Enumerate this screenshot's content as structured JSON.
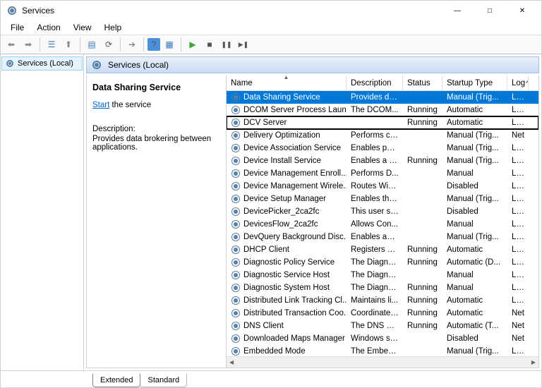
{
  "window": {
    "title": "Services"
  },
  "menu": {
    "file": "File",
    "action": "Action",
    "view": "View",
    "help": "Help"
  },
  "tree": {
    "root": "Services (Local)"
  },
  "header": {
    "title": "Services (Local)"
  },
  "detail": {
    "title": "Data Sharing Service",
    "start_link": "Start",
    "start_rest": " the service",
    "desc_label": "Description:",
    "desc_text": "Provides data brokering between applications."
  },
  "columns": {
    "name": "Name",
    "description": "Description",
    "status": "Status",
    "startup": "Startup Type",
    "logon": "Log"
  },
  "tabs": {
    "extended": "Extended",
    "standard": "Standard"
  },
  "services": [
    {
      "name": "Data Sharing Service",
      "desc": "Provides da...",
      "status": "",
      "startup": "Manual (Trig...",
      "log": "Loc",
      "sel": true
    },
    {
      "name": "DCOM Server Process Laun...",
      "desc": "The DCOM...",
      "status": "Running",
      "startup": "Automatic",
      "log": "Loc"
    },
    {
      "name": "DCV Server",
      "desc": "",
      "status": "Running",
      "startup": "Automatic",
      "log": "Loc",
      "hl": true
    },
    {
      "name": "Delivery Optimization",
      "desc": "Performs co...",
      "status": "",
      "startup": "Manual (Trig...",
      "log": "Net"
    },
    {
      "name": "Device Association Service",
      "desc": "Enables pair...",
      "status": "",
      "startup": "Manual (Trig...",
      "log": "Loc"
    },
    {
      "name": "Device Install Service",
      "desc": "Enables a c...",
      "status": "Running",
      "startup": "Manual (Trig...",
      "log": "Loc"
    },
    {
      "name": "Device Management Enroll...",
      "desc": "Performs D...",
      "status": "",
      "startup": "Manual",
      "log": "Loc"
    },
    {
      "name": "Device Management Wirele...",
      "desc": "Routes Wire...",
      "status": "",
      "startup": "Disabled",
      "log": "Loc"
    },
    {
      "name": "Device Setup Manager",
      "desc": "Enables the ...",
      "status": "",
      "startup": "Manual (Trig...",
      "log": "Loc"
    },
    {
      "name": "DevicePicker_2ca2fc",
      "desc": "This user se...",
      "status": "",
      "startup": "Disabled",
      "log": "Loc"
    },
    {
      "name": "DevicesFlow_2ca2fc",
      "desc": "Allows Con...",
      "status": "",
      "startup": "Manual",
      "log": "Loc"
    },
    {
      "name": "DevQuery Background Disc...",
      "desc": "Enables app...",
      "status": "",
      "startup": "Manual (Trig...",
      "log": "Loc"
    },
    {
      "name": "DHCP Client",
      "desc": "Registers an...",
      "status": "Running",
      "startup": "Automatic",
      "log": "Loc"
    },
    {
      "name": "Diagnostic Policy Service",
      "desc": "The Diagno...",
      "status": "Running",
      "startup": "Automatic (D...",
      "log": "Loc"
    },
    {
      "name": "Diagnostic Service Host",
      "desc": "The Diagno...",
      "status": "",
      "startup": "Manual",
      "log": "Loc"
    },
    {
      "name": "Diagnostic System Host",
      "desc": "The Diagno...",
      "status": "Running",
      "startup": "Manual",
      "log": "Loc"
    },
    {
      "name": "Distributed Link Tracking Cl...",
      "desc": "Maintains li...",
      "status": "Running",
      "startup": "Automatic",
      "log": "Loc"
    },
    {
      "name": "Distributed Transaction Coo...",
      "desc": "Coordinates...",
      "status": "Running",
      "startup": "Automatic",
      "log": "Net"
    },
    {
      "name": "DNS Client",
      "desc": "The DNS Cli...",
      "status": "Running",
      "startup": "Automatic (T...",
      "log": "Net"
    },
    {
      "name": "Downloaded Maps Manager",
      "desc": "Windows se...",
      "status": "",
      "startup": "Disabled",
      "log": "Net"
    },
    {
      "name": "Embedded Mode",
      "desc": "The Embed...",
      "status": "",
      "startup": "Manual (Trig...",
      "log": "Loc"
    }
  ]
}
